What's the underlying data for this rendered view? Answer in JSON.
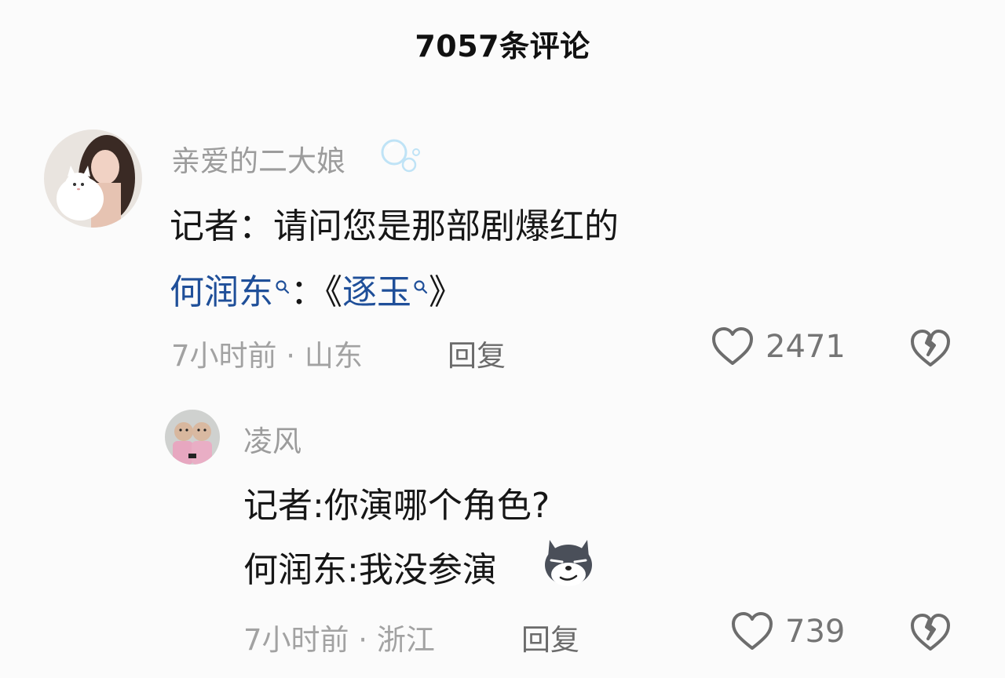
{
  "header": {
    "title": "7057条评论"
  },
  "comments": [
    {
      "avatar_icon": "user-avatar-girl-with-cat",
      "username": "亲爱的二大娘",
      "username_badge_icon": "bubble-badge-icon",
      "line1": "记者：请问您是那部剧爆红的",
      "line2_link1": "何润东",
      "line2_sep": "：《",
      "line2_link2": "逐玉",
      "line2_end": "》",
      "time_location": "7小时前 · 山东",
      "reply_label": "回复",
      "like_count": "2471",
      "like_icon": "heart-outline-icon",
      "dislike_icon": "broken-heart-icon"
    },
    {
      "avatar_icon": "user-avatar-twin-babies",
      "username": "凌风",
      "line1": "记者:你演哪个角色?",
      "line2": "何润东:我没参演",
      "emoji_icon": "smirking-wolf-emoji",
      "time_location": "7小时前 · 浙江",
      "reply_label": "回复",
      "like_count": "739",
      "like_icon": "heart-outline-icon",
      "dislike_icon": "broken-heart-icon"
    }
  ],
  "colors": {
    "background": "#fbfbfb",
    "text": "#161616",
    "muted": "#a2a2a2",
    "link": "#1f4f99"
  }
}
